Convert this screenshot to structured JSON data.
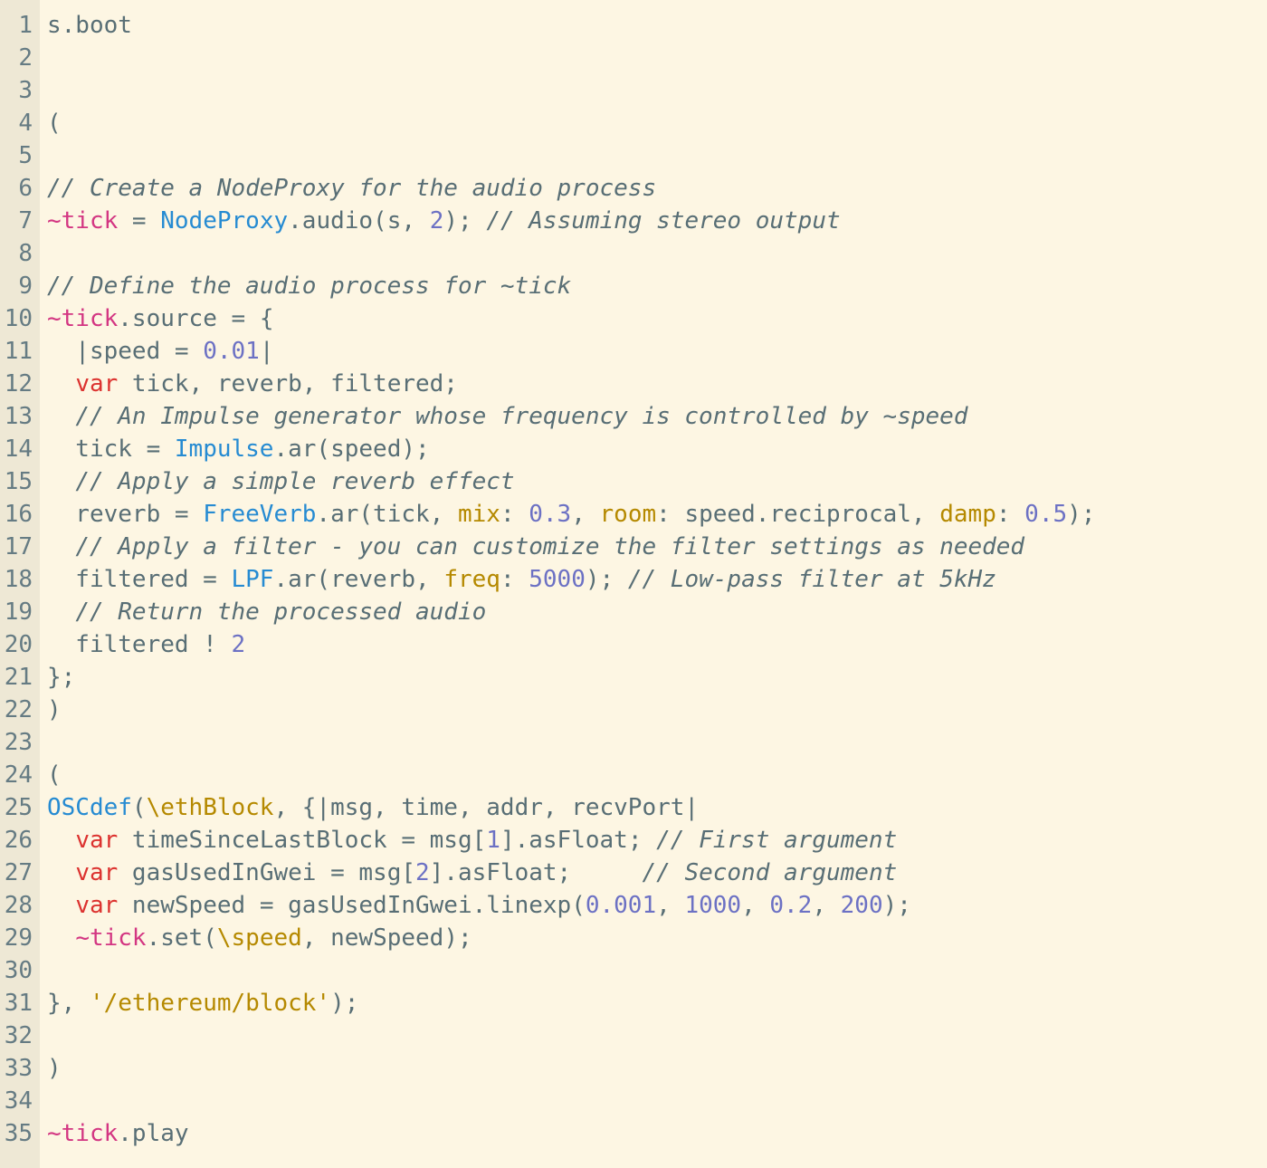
{
  "editor": {
    "language": "SuperCollider",
    "colors": {
      "background": "#fdf6e3",
      "gutter": "#eee8d5",
      "text": "#586e75",
      "environment_var": "#d33682",
      "class": "#268bd2",
      "number": "#6c71c4",
      "keyword": "#dc322f",
      "symbol": "#b58900",
      "comment": "#586e75"
    },
    "lines": [
      {
        "n": "1",
        "tokens": [
          {
            "t": "s.boot",
            "c": ""
          }
        ]
      },
      {
        "n": "2",
        "tokens": []
      },
      {
        "n": "3",
        "tokens": []
      },
      {
        "n": "4",
        "tokens": [
          {
            "t": "(",
            "c": ""
          }
        ]
      },
      {
        "n": "5",
        "tokens": []
      },
      {
        "n": "6",
        "tokens": [
          {
            "t": "// Create a NodeProxy for the audio process",
            "c": "comment"
          }
        ]
      },
      {
        "n": "7",
        "tokens": [
          {
            "t": "~tick",
            "c": "env"
          },
          {
            "t": " = ",
            "c": ""
          },
          {
            "t": "NodeProxy",
            "c": "cls"
          },
          {
            "t": ".audio(s, ",
            "c": ""
          },
          {
            "t": "2",
            "c": "num"
          },
          {
            "t": "); ",
            "c": ""
          },
          {
            "t": "// Assuming stereo output",
            "c": "comment"
          }
        ]
      },
      {
        "n": "8",
        "tokens": []
      },
      {
        "n": "9",
        "tokens": [
          {
            "t": "// Define the audio process for ~tick",
            "c": "comment"
          }
        ]
      },
      {
        "n": "10",
        "tokens": [
          {
            "t": "~tick",
            "c": "env"
          },
          {
            "t": ".source = {",
            "c": ""
          }
        ]
      },
      {
        "n": "11",
        "tokens": [
          {
            "t": "  |speed = ",
            "c": ""
          },
          {
            "t": "0.01",
            "c": "num"
          },
          {
            "t": "|",
            "c": ""
          }
        ]
      },
      {
        "n": "12",
        "tokens": [
          {
            "t": "  ",
            "c": ""
          },
          {
            "t": "var",
            "c": "kw"
          },
          {
            "t": " tick, reverb, filtered;",
            "c": ""
          }
        ]
      },
      {
        "n": "13",
        "tokens": [
          {
            "t": "  ",
            "c": ""
          },
          {
            "t": "// An Impulse generator whose frequency is controlled by ~speed",
            "c": "comment"
          }
        ]
      },
      {
        "n": "14",
        "tokens": [
          {
            "t": "  tick = ",
            "c": ""
          },
          {
            "t": "Impulse",
            "c": "cls"
          },
          {
            "t": ".ar(speed);",
            "c": ""
          }
        ]
      },
      {
        "n": "15",
        "tokens": [
          {
            "t": "  ",
            "c": ""
          },
          {
            "t": "// Apply a simple reverb effect",
            "c": "comment"
          }
        ]
      },
      {
        "n": "16",
        "tokens": [
          {
            "t": "  reverb = ",
            "c": ""
          },
          {
            "t": "FreeVerb",
            "c": "cls"
          },
          {
            "t": ".ar(tick, ",
            "c": ""
          },
          {
            "t": "mix",
            "c": "sym"
          },
          {
            "t": ": ",
            "c": ""
          },
          {
            "t": "0.3",
            "c": "num"
          },
          {
            "t": ", ",
            "c": ""
          },
          {
            "t": "room",
            "c": "sym"
          },
          {
            "t": ": speed.reciprocal, ",
            "c": ""
          },
          {
            "t": "damp",
            "c": "sym"
          },
          {
            "t": ": ",
            "c": ""
          },
          {
            "t": "0.5",
            "c": "num"
          },
          {
            "t": ");",
            "c": ""
          }
        ]
      },
      {
        "n": "17",
        "tokens": [
          {
            "t": "  ",
            "c": ""
          },
          {
            "t": "// Apply a filter - you can customize the filter settings as needed",
            "c": "comment"
          }
        ]
      },
      {
        "n": "18",
        "tokens": [
          {
            "t": "  filtered = ",
            "c": ""
          },
          {
            "t": "LPF",
            "c": "cls"
          },
          {
            "t": ".ar(reverb, ",
            "c": ""
          },
          {
            "t": "freq",
            "c": "sym"
          },
          {
            "t": ": ",
            "c": ""
          },
          {
            "t": "5000",
            "c": "num"
          },
          {
            "t": "); ",
            "c": ""
          },
          {
            "t": "// Low-pass filter at 5kHz",
            "c": "comment"
          }
        ]
      },
      {
        "n": "19",
        "tokens": [
          {
            "t": "  ",
            "c": ""
          },
          {
            "t": "// Return the processed audio",
            "c": "comment"
          }
        ]
      },
      {
        "n": "20",
        "tokens": [
          {
            "t": "  filtered ! ",
            "c": ""
          },
          {
            "t": "2",
            "c": "num"
          }
        ]
      },
      {
        "n": "21",
        "tokens": [
          {
            "t": "};",
            "c": ""
          }
        ]
      },
      {
        "n": "22",
        "tokens": [
          {
            "t": ")",
            "c": ""
          }
        ]
      },
      {
        "n": "23",
        "tokens": []
      },
      {
        "n": "24",
        "tokens": [
          {
            "t": "(",
            "c": ""
          }
        ]
      },
      {
        "n": "25",
        "tokens": [
          {
            "t": "OSCdef",
            "c": "cls"
          },
          {
            "t": "(",
            "c": ""
          },
          {
            "t": "\\ethBlock",
            "c": "sym"
          },
          {
            "t": ", {|msg, time, addr, recvPort|",
            "c": ""
          }
        ]
      },
      {
        "n": "26",
        "tokens": [
          {
            "t": "  ",
            "c": ""
          },
          {
            "t": "var",
            "c": "kw"
          },
          {
            "t": " timeSinceLastBlock = msg[",
            "c": ""
          },
          {
            "t": "1",
            "c": "num"
          },
          {
            "t": "].asFloat; ",
            "c": ""
          },
          {
            "t": "// First argument",
            "c": "comment"
          }
        ]
      },
      {
        "n": "27",
        "tokens": [
          {
            "t": "  ",
            "c": ""
          },
          {
            "t": "var",
            "c": "kw"
          },
          {
            "t": " gasUsedInGwei = msg[",
            "c": ""
          },
          {
            "t": "2",
            "c": "num"
          },
          {
            "t": "].asFloat;     ",
            "c": ""
          },
          {
            "t": "// Second argument",
            "c": "comment"
          }
        ]
      },
      {
        "n": "28",
        "tokens": [
          {
            "t": "  ",
            "c": ""
          },
          {
            "t": "var",
            "c": "kw"
          },
          {
            "t": " newSpeed = gasUsedInGwei.linexp(",
            "c": ""
          },
          {
            "t": "0.001",
            "c": "num"
          },
          {
            "t": ", ",
            "c": ""
          },
          {
            "t": "1000",
            "c": "num"
          },
          {
            "t": ", ",
            "c": ""
          },
          {
            "t": "0.2",
            "c": "num"
          },
          {
            "t": ", ",
            "c": ""
          },
          {
            "t": "200",
            "c": "num"
          },
          {
            "t": ");",
            "c": ""
          }
        ]
      },
      {
        "n": "29",
        "tokens": [
          {
            "t": "  ",
            "c": ""
          },
          {
            "t": "~tick",
            "c": "env"
          },
          {
            "t": ".set(",
            "c": ""
          },
          {
            "t": "\\speed",
            "c": "sym"
          },
          {
            "t": ", newSpeed);",
            "c": ""
          }
        ]
      },
      {
        "n": "30",
        "tokens": []
      },
      {
        "n": "31",
        "tokens": [
          {
            "t": "}, ",
            "c": ""
          },
          {
            "t": "'/ethereum/block'",
            "c": "sym"
          },
          {
            "t": ");",
            "c": ""
          }
        ]
      },
      {
        "n": "32",
        "tokens": []
      },
      {
        "n": "33",
        "tokens": [
          {
            "t": ")",
            "c": ""
          }
        ]
      },
      {
        "n": "34",
        "tokens": []
      },
      {
        "n": "35",
        "tokens": [
          {
            "t": "~tick",
            "c": "env"
          },
          {
            "t": ".play",
            "c": ""
          }
        ]
      }
    ]
  }
}
